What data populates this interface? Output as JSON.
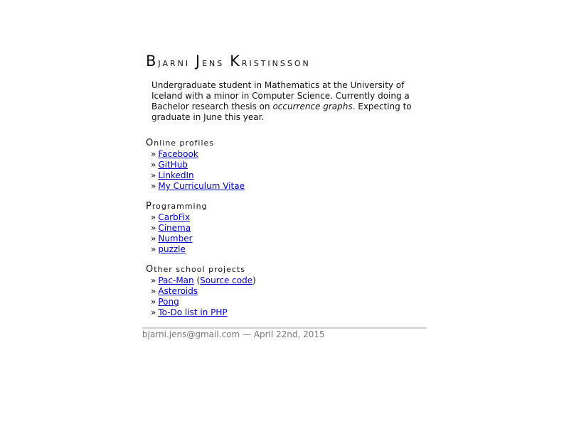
{
  "header": {
    "name_parts": [
      {
        "initial": "B",
        "rest": "jarni"
      },
      {
        "initial": "J",
        "rest": "ens"
      },
      {
        "initial": "K",
        "rest": "ristinsson"
      }
    ]
  },
  "intro": {
    "text_before": "Undergraduate student in Mathematics at the University of Iceland with a minor in Computer Science. Currently doing a Bachelor research thesis on ",
    "emphasis": "occurrence graphs",
    "text_after": ". Expecting to graduate in June this year."
  },
  "bullet": "»",
  "sections": {
    "online_profiles": {
      "title_initial": "O",
      "title_rest": "nline profiles",
      "items": [
        "Facebook",
        "GitHub",
        "LinkedIn",
        "My Curriculum Vitae"
      ]
    },
    "programming": {
      "title_initial": "P",
      "title_rest": "rogramming",
      "items": [
        "CarbFix",
        "Cinema",
        "Number",
        "puzzle"
      ]
    },
    "school_projects": {
      "title_initial": "O",
      "title_rest": "ther school projects",
      "pacman": {
        "label": "Pac-Man",
        "source_label": "Source code",
        "open": "(",
        "close": ")"
      },
      "items": [
        "Asteroids",
        "Pong",
        "To-Do list in PHP"
      ]
    }
  },
  "footer": {
    "text": "bjarni.jens@gmail.com — April 22nd, 2015"
  },
  "colors": {
    "link": "#0000cc",
    "footer_text": "#777777",
    "rule": "#cfcfcf"
  }
}
